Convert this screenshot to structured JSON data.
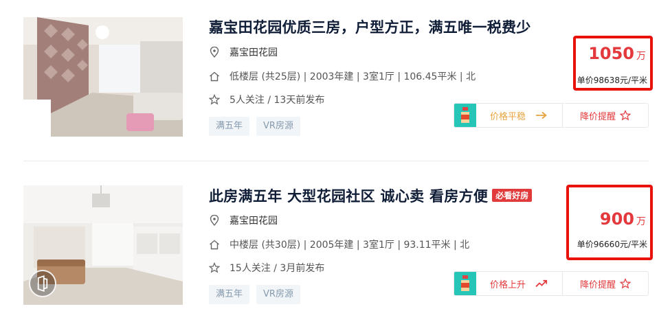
{
  "listings": [
    {
      "title": "嘉宝田花园优质三房，户型方正，满五唯一税费少",
      "hot_tag": "",
      "community": "嘉宝田花园",
      "house_info": "低楼层 (共25层) | 2003年建 | 3室1厅 | 106.45平米 | 北",
      "follow_info": "5人关注 / 13天前发布",
      "tags": [
        "满五年",
        "VR房源"
      ],
      "total_price": "1050",
      "total_unit": "万",
      "unit_price": "单价98638元/平米",
      "trend_label": "价格平稳",
      "trend_icon": "arrow-right-icon",
      "remind_label": "降价提醒"
    },
    {
      "title": "此房满五年 大型花园社区 诚心卖 看房方便",
      "hot_tag": "必看好房",
      "community": "嘉宝田花园",
      "house_info": "中楼层 (共30层) | 2005年建 | 3室1厅 | 93.11平米 | 北",
      "follow_info": "15人关注 / 3月前发布",
      "tags": [
        "满五年",
        "VR房源"
      ],
      "total_price": "900",
      "total_unit": "万",
      "unit_price": "单价96660元/平米",
      "trend_label": "价格上升",
      "trend_icon": "trend-up-icon",
      "remind_label": "降价提醒"
    }
  ],
  "colors": {
    "price": "#e4393c",
    "highlight_box": "#e8110b",
    "trend_flat": "#e8a33d",
    "trend_icon_bg": "#25c6b8",
    "tag_text": "#849aae",
    "tag_bg": "#f2f5f8"
  }
}
